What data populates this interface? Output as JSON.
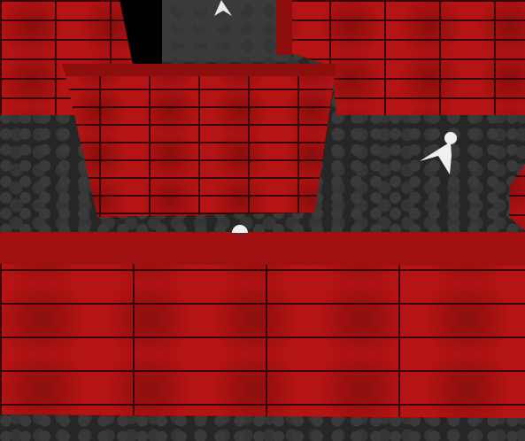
{
  "scene": {
    "type": "3d-maze",
    "colors": {
      "wall": "#b51414",
      "mortar": "#3a0505",
      "floor": "#262626",
      "ghost": "#f0f0f0"
    },
    "entities": [
      {
        "kind": "ghost",
        "location": "right-corridor"
      },
      {
        "kind": "ghost",
        "location": "far-corridor"
      },
      {
        "kind": "ghost",
        "location": "behind-front-wall"
      }
    ]
  }
}
